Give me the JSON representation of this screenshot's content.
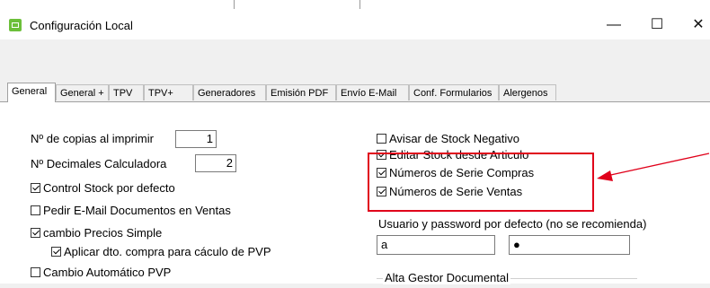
{
  "window": {
    "title": "Configuración Local",
    "controls": {
      "minimize": "—",
      "maximize": "☐",
      "close": "✕"
    }
  },
  "tabs": [
    {
      "label": "General",
      "active": true
    },
    {
      "label": "General +"
    },
    {
      "label": "TPV"
    },
    {
      "label": "TPV+"
    },
    {
      "label": "Generadores"
    },
    {
      "label": "Emisión PDF"
    },
    {
      "label": "Envío E-Mail"
    },
    {
      "label": "Conf. Formularios"
    },
    {
      "label": "Alergenos"
    }
  ],
  "left": {
    "copias_label": "Nº de copias al imprimir",
    "copias_value": "1",
    "decimales_label": "Nº Decimales Calculadora",
    "decimales_value": "2",
    "control_stock": "Control Stock por defecto",
    "pedir_email": "Pedir E-Mail Documentos en Ventas",
    "cambio_precios": "cambio Precios Simple",
    "aplicar_dto": "Aplicar dto. compra para cáculo de PVP",
    "cambio_auto": "Cambio Automático PVP"
  },
  "right": {
    "avisar_stock": "Avisar de Stock Negativo",
    "editar_stock": "Editar Stock desde Articulo",
    "num_serie_compras": "Números de Serie Compras",
    "num_serie_ventas": "Números de Serie Ventas",
    "usuario_label": "Usuario y password por defecto (no se recomienda)",
    "usuario_value": "a",
    "password_value": "●",
    "gestor_label": "Alta  Gestor Documental"
  },
  "checked": {
    "control_stock": true,
    "pedir_email": false,
    "cambio_precios": true,
    "aplicar_dto": true,
    "cambio_auto": false,
    "avisar_stock": false,
    "editar_stock": true,
    "num_serie_compras": true,
    "num_serie_ventas": true
  },
  "colors": {
    "annotation_red": "#e0001a",
    "app_icon_green": "#6cbf3a"
  }
}
